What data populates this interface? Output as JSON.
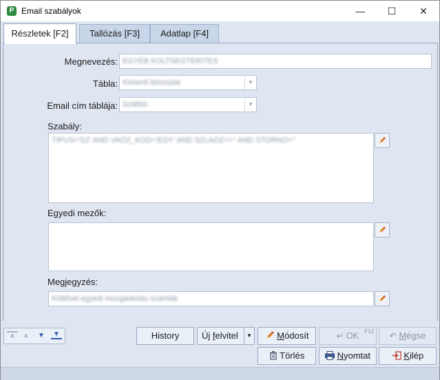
{
  "window": {
    "title": "Email szabályok",
    "app_icon_letter": "P",
    "minimize": "—",
    "maximize": "☐",
    "close": "✕"
  },
  "tabs": [
    {
      "label": "Részletek [F2]",
      "active": true
    },
    {
      "label": "Tallózás [F3]",
      "active": false
    },
    {
      "label": "Adatlap [F4]",
      "active": false
    }
  ],
  "form": {
    "megnevezes_label": "Megnevezés:",
    "megnevezes_value": "EGYEB KOLTSEGTERITES",
    "tabla_label": "Tábla:",
    "tabla_value": "Kimenő bizonylat",
    "email_tabla_label": "Email cím táblája:",
    "email_tabla_value": "Szállító",
    "szabaly_label": "Szabály:",
    "szabaly_value": "TIPUS='SZ' AND VAOZ_KOD='EGY' AND SZLAOZ<>'' AND STORNO=''",
    "egyedi_label": "Egyedi mezők:",
    "egyedi_value": "",
    "megjegyzes_label": "Megjegyzés:",
    "megjegyzes_value": "Költővel egyedi mozgáskódu számlák"
  },
  "buttons": {
    "history": "History",
    "uj_felvitel_pre": "Új ",
    "uj_felvitel_u": "f",
    "uj_felvitel_post": "elvitel",
    "modosit_pre": "",
    "modosit_u": "M",
    "modosit_post": "ódosít",
    "ok": "OK",
    "ok_hotkey": "F12",
    "megse_pre": "",
    "megse_u": "M",
    "megse_post": "égse",
    "torles": "Törlés",
    "nyomtat_pre": "",
    "nyomtat_u": "N",
    "nyomtat_post": "yomtat",
    "kilep_pre": "",
    "kilep_u": "K",
    "kilep_post": "ilép"
  },
  "nav": {
    "first": "▲",
    "prev": "▲",
    "next": "▼",
    "last": "▼"
  },
  "colors": {
    "accent": "#2e8b3e",
    "nav_active": "#2f56b0",
    "nav_disabled": "#a8b3c4",
    "pencil": "#e07a1c"
  }
}
